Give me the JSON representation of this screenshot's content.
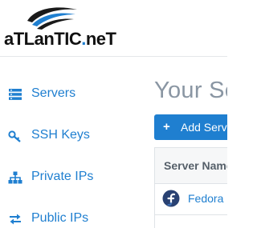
{
  "brand": {
    "logo_text_main": "aTLanTIC",
    "logo_text_dot": ".",
    "logo_text_tld": "neT",
    "accent_color": "#1f7fd0"
  },
  "sidebar": {
    "items": [
      {
        "label": "Servers",
        "icon": "servers-icon"
      },
      {
        "label": "SSH Keys",
        "icon": "key-icon"
      },
      {
        "label": "Private IPs",
        "icon": "network-icon"
      },
      {
        "label": "Public IPs",
        "icon": "swap-arrows-icon"
      }
    ]
  },
  "main": {
    "title": "Your Servers",
    "add_button_label": "Add Server",
    "table": {
      "columns": [
        "Server Name"
      ],
      "rows": [
        {
          "os_icon": "fedora-icon",
          "name": "Fedora"
        }
      ]
    }
  }
}
